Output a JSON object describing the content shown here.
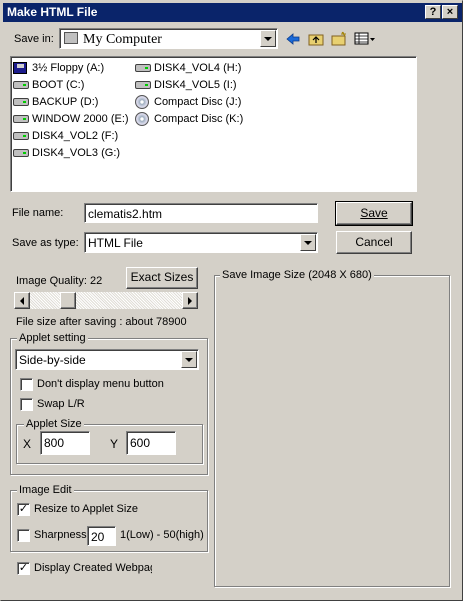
{
  "window": {
    "title": "Make HTML File",
    "help_btn": "?",
    "close_btn": "×"
  },
  "save_in": {
    "label": "Save in:",
    "value": "My Computer"
  },
  "drives": [
    {
      "label": "3½ Floppy (A:)",
      "icon": "floppy-icon"
    },
    {
      "label": "BOOT (C:)",
      "icon": "hard-drive-icon"
    },
    {
      "label": "BACKUP (D:)",
      "icon": "hard-drive-icon"
    },
    {
      "label": "WINDOW 2000 (E:)",
      "icon": "hard-drive-icon"
    },
    {
      "label": "DISK4_VOL2 (F:)",
      "icon": "hard-drive-icon"
    },
    {
      "label": "DISK4_VOL3 (G:)",
      "icon": "hard-drive-icon"
    },
    {
      "label": "DISK4_VOL4 (H:)",
      "icon": "hard-drive-icon"
    },
    {
      "label": "DISK4_VOL5 (I:)",
      "icon": "hard-drive-icon"
    },
    {
      "label": "Compact Disc (J:)",
      "icon": "cd-icon"
    },
    {
      "label": "Compact Disc (K:)",
      "icon": "cd-icon"
    }
  ],
  "file_name": {
    "label": "File name:",
    "value": "clematis2.htm"
  },
  "save_as_type": {
    "label": "Save as type:",
    "value": "HTML File"
  },
  "buttons": {
    "save": "Save",
    "cancel": "Cancel",
    "exact_sizes": "Exact Sizes"
  },
  "image_quality": {
    "label": "Image Quality:",
    "value": "22",
    "fraction": 0.22
  },
  "file_size": {
    "text": "File size after saving : about 78900"
  },
  "applet_setting": {
    "legend": "Applet setting",
    "mode": "Side-by-side",
    "dont_display_menu": {
      "label": "Don't display menu button",
      "checked": false
    },
    "swap_lr": {
      "label": "Swap L/R",
      "checked": false
    },
    "applet_size": {
      "legend": "Applet Size",
      "x_label": "X",
      "x_value": "800",
      "y_label": "Y",
      "y_value": "600"
    }
  },
  "image_edit": {
    "legend": "Image Edit",
    "resize": {
      "label": "Resize to Applet Size",
      "checked": true
    },
    "sharpness": {
      "label": "Sharpness",
      "value": "20",
      "range": "1(Low) - 50(high)",
      "checked": false
    }
  },
  "display_created": {
    "label": "Display Created Webpag",
    "checked": true
  },
  "save_image_size": {
    "legend": "Save Image Size (2048 X 680)"
  },
  "colors": {
    "title_bar": "#0a246a",
    "face": "#d4d0c8"
  }
}
